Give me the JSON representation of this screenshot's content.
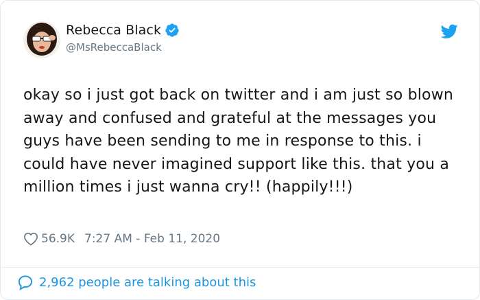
{
  "author": {
    "name": "Rebecca Black",
    "handle": "@MsRebeccaBlack"
  },
  "tweet": {
    "text": "okay so i just got back on twitter and i am just so blown away and confused and grateful at the messages you guys have been sending to me in response to this. i could have never imagined support like this. that you a million times i just wanna cry!! (happily!!!)"
  },
  "meta": {
    "likes": "56.9K",
    "timestamp": "7:27 AM - Feb 11, 2020"
  },
  "footer": {
    "talking": "2,962 people are talking about this"
  },
  "colors": {
    "twitter_blue": "#1da1f2",
    "link_blue": "#1b95e0",
    "secondary_text": "#657786"
  },
  "icons": {
    "verified": "verified-badge-icon",
    "bird": "twitter-bird-icon",
    "heart": "heart-icon",
    "bubble": "speech-bubble-icon"
  }
}
